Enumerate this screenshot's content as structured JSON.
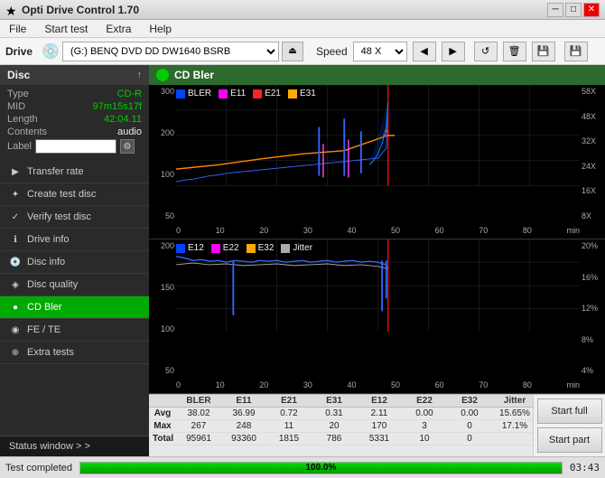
{
  "titleBar": {
    "icon": "★",
    "title": "Opti Drive Control 1.70",
    "minimize": "─",
    "maximize": "□",
    "close": "✕"
  },
  "menuBar": {
    "items": [
      "File",
      "Start test",
      "Extra",
      "Help"
    ]
  },
  "driveBar": {
    "label": "Drive",
    "driveValue": "(G:)  BENQ DVD DD DW1640 BSRB",
    "speedLabel": "Speed",
    "speedValue": "48 X",
    "ejectIcon": "⏏"
  },
  "sidebar": {
    "disc": {
      "header": "Disc",
      "arrowIcon": "↑",
      "type_key": "Type",
      "type_val": "CD-R",
      "mid_key": "MID",
      "mid_val": "97m15s17f",
      "length_key": "Length",
      "length_val": "42:04.11",
      "contents_key": "Contents",
      "contents_val": "audio",
      "label_key": "Label",
      "label_val": "",
      "gearIcon": "⚙"
    },
    "buttons": [
      {
        "id": "transfer-rate",
        "icon": "▶",
        "label": "Transfer rate",
        "active": false
      },
      {
        "id": "create-test-disc",
        "icon": "✦",
        "label": "Create test disc",
        "active": false
      },
      {
        "id": "verify-test-disc",
        "icon": "✓",
        "label": "Verify test disc",
        "active": false
      },
      {
        "id": "drive-info",
        "icon": "ℹ",
        "label": "Drive info",
        "active": false
      },
      {
        "id": "disc-info",
        "icon": "💿",
        "label": "Disc info",
        "active": false
      },
      {
        "id": "disc-quality",
        "icon": "◈",
        "label": "Disc quality",
        "active": false
      },
      {
        "id": "cd-bler",
        "icon": "●",
        "label": "CD Bler",
        "active": true
      },
      {
        "id": "fe-te",
        "icon": "◉",
        "label": "FE / TE",
        "active": false
      },
      {
        "id": "extra-tests",
        "icon": "⊕",
        "label": "Extra tests",
        "active": false
      }
    ],
    "statusWindow": "Status window > >"
  },
  "chartHeader": {
    "icon": "●",
    "title": "CD Bler"
  },
  "chart1": {
    "legend": [
      {
        "color": "#0055ff",
        "label": "BLER"
      },
      {
        "color": "#ff44ff",
        "label": "E11"
      },
      {
        "color": "#ff0000",
        "label": "E21"
      },
      {
        "color": "#ffaa00",
        "label": "E31"
      }
    ],
    "yAxisLeft": [
      "300",
      "200",
      "100",
      "50"
    ],
    "yAxisRight": [
      "58X",
      "48X",
      "32X",
      "24X",
      "16X",
      "8X"
    ],
    "xAxisLabels": [
      "0",
      "10",
      "20",
      "30",
      "40",
      "50",
      "60",
      "70",
      "80",
      "min"
    ]
  },
  "chart2": {
    "legend": [
      {
        "color": "#0055ff",
        "label": "E12"
      },
      {
        "color": "#ff44ff",
        "label": "E22"
      },
      {
        "color": "#ffaa00",
        "label": "E32"
      },
      {
        "color": "#aaaaaa",
        "label": "Jitter"
      }
    ],
    "yAxisLeft": [
      "200",
      "150",
      "100",
      "50"
    ],
    "yAxisRight": [
      "20%",
      "16%",
      "12%",
      "8%",
      "4%"
    ],
    "xAxisLabels": [
      "0",
      "10",
      "20",
      "30",
      "40",
      "50",
      "60",
      "70",
      "80",
      "min"
    ]
  },
  "dataTable": {
    "headers": [
      "",
      "BLER",
      "E11",
      "E21",
      "E31",
      "E12",
      "E22",
      "E32",
      "Jitter"
    ],
    "rows": [
      {
        "label": "Avg",
        "values": [
          "38.02",
          "36.99",
          "0.72",
          "0.31",
          "2.11",
          "0.00",
          "0.00",
          "15.65%"
        ]
      },
      {
        "label": "Max",
        "values": [
          "267",
          "248",
          "11",
          "20",
          "170",
          "3",
          "0",
          "17.1%"
        ]
      },
      {
        "label": "Total",
        "values": [
          "95961",
          "93360",
          "1815",
          "786",
          "5331",
          "10",
          "0",
          ""
        ]
      }
    ]
  },
  "actions": {
    "startFull": "Start full",
    "startPart": "Start part"
  },
  "bottomBar": {
    "statusText": "Test completed",
    "progressPercent": 100,
    "progressLabel": "100.0%",
    "time": "03:43"
  }
}
